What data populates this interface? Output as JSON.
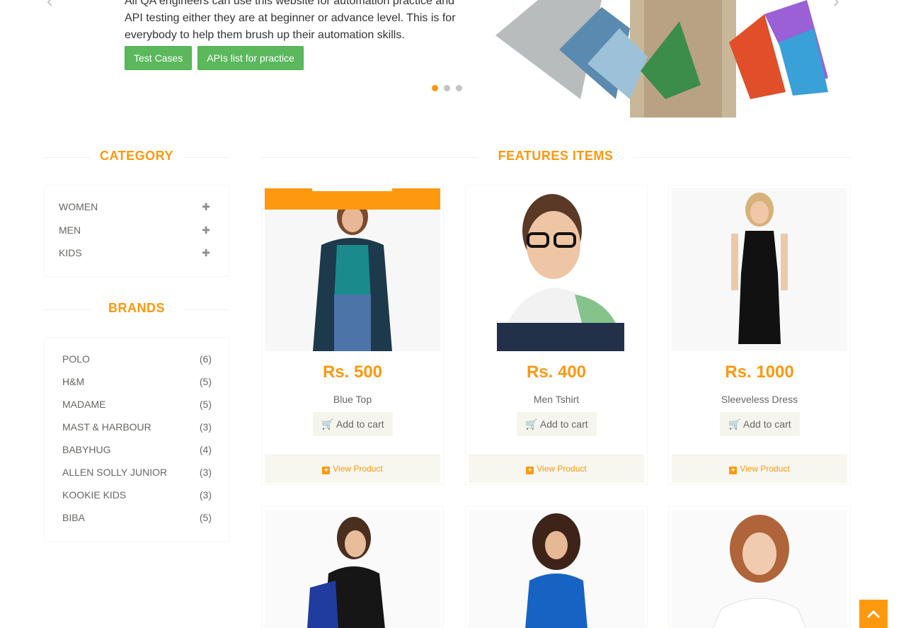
{
  "slider": {
    "text_line_top": "All QA engineers can use this website for automation practice and",
    "text": "API testing either they are at beginner or advance level. This is for everybody to help them brush up their automation skills.",
    "buttons": [
      "Test Cases",
      "APIs list for practice"
    ],
    "dots": 3,
    "active_dot": 0
  },
  "sidebar": {
    "category_title": "CATEGORY",
    "categories": [
      "WOMEN",
      "MEN",
      "KIDS"
    ],
    "brands_title": "BRANDS",
    "brands": [
      {
        "name": "POLO",
        "count": "(6)"
      },
      {
        "name": "H&M",
        "count": "(5)"
      },
      {
        "name": "MADAME",
        "count": "(5)"
      },
      {
        "name": "MAST & HARBOUR",
        "count": "(3)"
      },
      {
        "name": "BABYHUG",
        "count": "(4)"
      },
      {
        "name": "ALLEN SOLLY JUNIOR",
        "count": "(3)"
      },
      {
        "name": "KOOKIE KIDS",
        "count": "(3)"
      },
      {
        "name": "BIBA",
        "count": "(5)"
      }
    ]
  },
  "features": {
    "title": "FEATURES ITEMS",
    "add_label": "Add to cart",
    "view_label": "View Product",
    "products": [
      {
        "price": "Rs. 500",
        "name": "Blue Top"
      },
      {
        "price": "Rs. 400",
        "name": "Men Tshirt"
      },
      {
        "price": "Rs. 1000",
        "name": "Sleeveless Dress"
      }
    ]
  },
  "colors": {
    "accent": "#FE980F",
    "button_green": "#5CB85C"
  }
}
